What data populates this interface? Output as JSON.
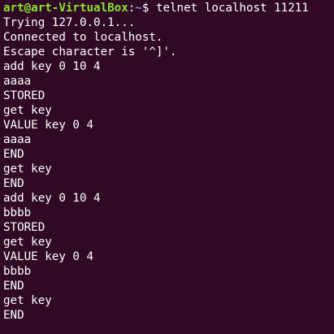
{
  "terminal": {
    "prompt": {
      "user_host": "art@art-VirtualBox",
      "colon": ":",
      "path": "~",
      "symbol": "$ ",
      "command": "telnet localhost 11211"
    },
    "output": [
      "Trying 127.0.0.1...",
      "Connected to localhost.",
      "Escape character is '^]'.",
      "add key 0 10 4",
      "aaaa",
      "STORED",
      "get key",
      "VALUE key 0 4",
      "aaaa",
      "END",
      "get key",
      "END",
      "add key 0 10 4",
      "bbbb",
      "STORED",
      "get key",
      "VALUE key 0 4",
      "bbbb",
      "END",
      "get key",
      "END"
    ]
  }
}
